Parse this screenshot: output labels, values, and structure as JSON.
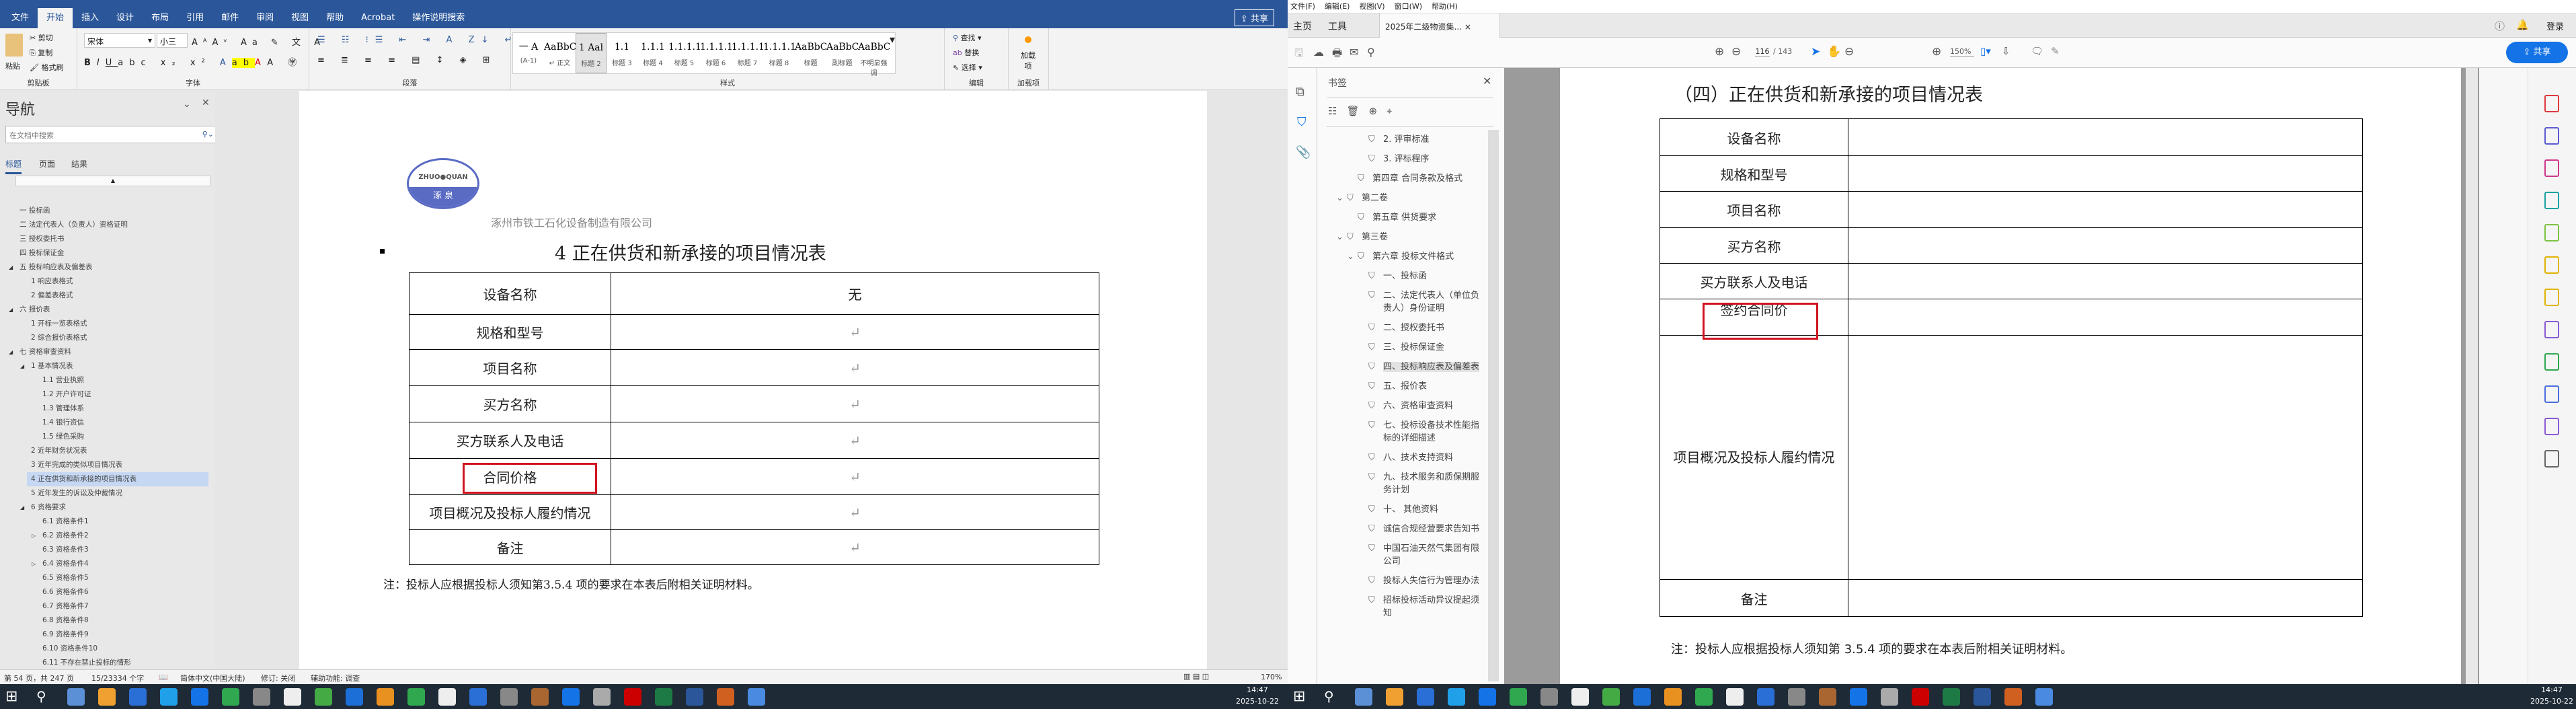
{
  "word": {
    "tabs": [
      "文件",
      "开始",
      "插入",
      "设计",
      "布局",
      "引用",
      "邮件",
      "审阅",
      "视图",
      "帮助",
      "Acrobat",
      "操作说明搜索"
    ],
    "active_tab": "开始",
    "share": "共享",
    "clipboard": {
      "paste": "粘贴",
      "cut": "剪切",
      "copy": "复制",
      "format_painter": "格式刷",
      "label": "剪贴板"
    },
    "font": {
      "name": "宋体",
      "size": "小三",
      "label": "字体"
    },
    "paragraph_label": "段落",
    "styles_label": "样式",
    "styles": [
      {
        "pv": "一  A",
        "name": "(A-1)"
      },
      {
        "pv": "AaBbCcDdE",
        "name": "↵ 正文"
      },
      {
        "pv": "1  Aal",
        "name": "标题 2",
        "sel": true
      },
      {
        "pv": "1.1",
        "name": "标题 3"
      },
      {
        "pv": "1.1.1",
        "name": "标题 4"
      },
      {
        "pv": "1.1.1.1",
        "name": "标题 5"
      },
      {
        "pv": "1.1.1.1",
        "name": "标题 6"
      },
      {
        "pv": "1.1.1.1",
        "name": "标题 7"
      },
      {
        "pv": "1.1.1.1.",
        "name": "标题 8"
      },
      {
        "pv": "AaBbC",
        "name": "标题"
      },
      {
        "pv": "AaBbC",
        "name": "副标题"
      },
      {
        "pv": "AaBbCcD",
        "name": "不明显强调"
      }
    ],
    "editing": {
      "find": "查找",
      "replace": "替换",
      "select": "选择",
      "label": "编辑"
    },
    "addins": {
      "btn": "加载项",
      "label": "加载项"
    },
    "nav": {
      "title": "导航",
      "search_placeholder": "在文档中搜索",
      "tabs": [
        "标题",
        "页面",
        "结果"
      ],
      "items": [
        {
          "t": "一 投标函",
          "l": 1
        },
        {
          "t": "二 法定代表人（负责人）资格证明",
          "l": 1
        },
        {
          "t": "三 授权委托书",
          "l": 1
        },
        {
          "t": "四 投标保证金",
          "l": 1
        },
        {
          "t": "五 投标响应表及偏差表",
          "l": 1,
          "exp": "open"
        },
        {
          "t": "1 响应表格式",
          "l": 2
        },
        {
          "t": "2 偏差表格式",
          "l": 2
        },
        {
          "t": "六 报价表",
          "l": 1,
          "exp": "open"
        },
        {
          "t": "1 开标一览表格式",
          "l": 2
        },
        {
          "t": "2 综合报价表格式",
          "l": 2
        },
        {
          "t": "七 资格审查资料",
          "l": 1,
          "exp": "open"
        },
        {
          "t": "1 基本情况表",
          "l": 2,
          "exp": "open"
        },
        {
          "t": "1.1 营业执照",
          "l": 3
        },
        {
          "t": "1.2 开户许可证",
          "l": 3
        },
        {
          "t": "1.3 管理体系",
          "l": 3
        },
        {
          "t": "1.4 银行资信",
          "l": 3
        },
        {
          "t": "1.5 绿色采购",
          "l": 3
        },
        {
          "t": "2 近年财务状况表",
          "l": 2
        },
        {
          "t": "3 近年完成的类似项目情况表",
          "l": 2
        },
        {
          "t": "4 正在供货和新承接的项目情况表",
          "l": 2,
          "sel": true
        },
        {
          "t": "5 近年发生的诉讼及仲裁情况",
          "l": 2
        },
        {
          "t": "6 资格要求",
          "l": 2,
          "exp": "open"
        },
        {
          "t": "6.1 资格条件1",
          "l": 3
        },
        {
          "t": "6.2 资格条件2",
          "l": 3,
          "exp": "closed"
        },
        {
          "t": "6.3 资格条件3",
          "l": 3
        },
        {
          "t": "6.4 资格条件4",
          "l": 3,
          "exp": "closed"
        },
        {
          "t": "6.5 资格条件5",
          "l": 3
        },
        {
          "t": "6.6 资格条件6",
          "l": 3
        },
        {
          "t": "6.7 资格条件7",
          "l": 3
        },
        {
          "t": "6.8 资格条件8",
          "l": 3
        },
        {
          "t": "6.9 资格条件9",
          "l": 3
        },
        {
          "t": "6.10 资格条件10",
          "l": 3
        },
        {
          "t": "6.11 不存在禁止投标的情形",
          "l": 3
        }
      ]
    },
    "doc": {
      "logo_text": "ZHUOQUAN 涿泉",
      "company": "涿州市铁工石化设备制造有限公司",
      "heading": "4   正在供货和新承接的项目情况表",
      "rows": [
        {
          "k": "设备名称",
          "v": "无"
        },
        {
          "k": "规格和型号",
          "v": "↵"
        },
        {
          "k": "项目名称",
          "v": "↵"
        },
        {
          "k": "买方名称",
          "v": "↵"
        },
        {
          "k": "买方联系人及电话",
          "v": "↵"
        },
        {
          "k": "合同价格",
          "v": "↵"
        },
        {
          "k": "项目概况及投标人履约情况",
          "v": "↵"
        },
        {
          "k": "备注",
          "v": "↵"
        }
      ],
      "note": "注：投标人应根据投标人须知第3.5.4 项的要求在本表后附相关证明材料。"
    },
    "status": {
      "page": "第 54 页，共 247 页",
      "words": "15/23334 个字",
      "lang": "简体中文(中国大陆)",
      "track": "修订: 关闭",
      "access": "辅助功能: 调查",
      "zoom": "170%"
    }
  },
  "pdf": {
    "menu": [
      "文件(F)",
      "编辑(E)",
      "视图(V)",
      "窗口(W)",
      "帮助(H)"
    ],
    "tabs": [
      "主页",
      "工具"
    ],
    "doc_tab": "2025年二级物资集...",
    "login": "登录",
    "page_current": "116",
    "page_total": "/ 143",
    "zoom": "150%",
    "share": "共享",
    "bookmarks": {
      "title": "书签",
      "items": [
        {
          "t": "2. 评审标准",
          "l": 3
        },
        {
          "t": "3. 评标程序",
          "l": 3
        },
        {
          "t": "第四章  合同条款及格式",
          "l": 2
        },
        {
          "t": "第二卷",
          "l": 1,
          "exp": true
        },
        {
          "t": "第五章  供货要求",
          "l": 2
        },
        {
          "t": "第三卷",
          "l": 1,
          "exp": true
        },
        {
          "t": "第六章  投标文件格式",
          "l": 2,
          "exp": true
        },
        {
          "t": "一、投标函",
          "l": 3
        },
        {
          "t": "二、法定代表人（单位负责人）身份证明",
          "l": 3
        },
        {
          "t": "二、授权委托书",
          "l": 3
        },
        {
          "t": "三、投标保证金",
          "l": 3
        },
        {
          "t": "四、投标响应表及偏差表",
          "l": 3,
          "sel": true
        },
        {
          "t": "五、报价表",
          "l": 3
        },
        {
          "t": "六、资格审查资料",
          "l": 3
        },
        {
          "t": "七、投标设备技术性能指标的详细描述",
          "l": 3
        },
        {
          "t": "八、技术支持资料",
          "l": 3
        },
        {
          "t": "九、技术服务和质保期服务计划",
          "l": 3
        },
        {
          "t": "十、 其他资料",
          "l": 3
        },
        {
          "t": "诚信合规经营要求告知书",
          "l": 3
        },
        {
          "t": "中国石油天然气集团有限公司",
          "l": 3
        },
        {
          "t": "投标人失信行为管理办法",
          "l": 3
        },
        {
          "t": "招标投标活动异议提起须知",
          "l": 3
        }
      ]
    },
    "doc": {
      "heading": "（四）正在供货和新承接的项目情况表",
      "rows": [
        "设备名称",
        "规格和型号",
        "项目名称",
        "买方名称",
        "买方联系人及电话",
        "签约合同价",
        "项目概况及投标人履约情况",
        "备注"
      ],
      "note": "注：投标人应根据投标人须知第 3.5.4 项的要求在本表后附相关证明材料。"
    }
  },
  "taskbar": {
    "time": "14:47",
    "date": "2025-10-22"
  },
  "colors": {
    "word_blue": "#2b579a",
    "acrobat_blue": "#1473e6",
    "highlight_red": "#d0141f"
  }
}
